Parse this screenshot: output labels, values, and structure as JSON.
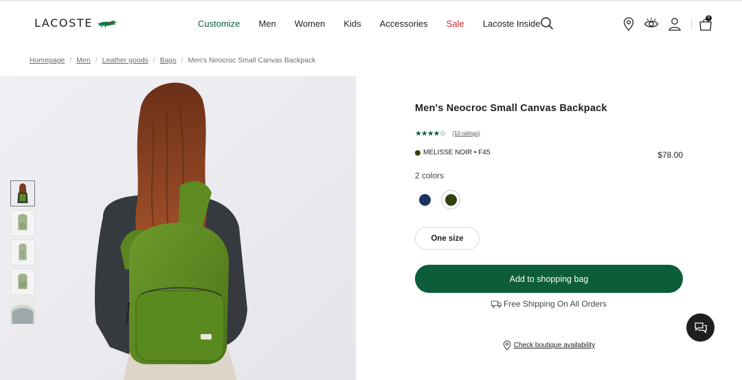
{
  "brand": {
    "name": "LACOSTE",
    "logo_icon": "crocodile-icon"
  },
  "nav": {
    "items": [
      "Customize",
      "Men",
      "Women",
      "Kids",
      "Accessories",
      "Sale",
      "Lacoste Inside"
    ],
    "search_icon": "search-icon"
  },
  "header_icons": {
    "store_locator": "location-pin-icon",
    "accessibility": "eye-icon",
    "account": "user-icon",
    "bag": "shopping-bag-icon",
    "bag_count": "0"
  },
  "breadcrumb": {
    "items": [
      "Homepage",
      "Men",
      "Leather goods",
      "Bags"
    ],
    "current": "Men's Neocroc Small Canvas Backpack"
  },
  "product": {
    "name": "Men's Neocroc Small Canvas Backpack",
    "rating_stars": 4,
    "rating_max": 5,
    "rating_text": "(10 ratings)",
    "variant_name": "MELISSE NOIR • F45",
    "price": "$78.00",
    "colors_label": "2 colors",
    "size_label": "One size",
    "add_to_bag_label": "Add to shopping bag",
    "shipping_text": "Free Shipping On All Orders",
    "boutique_text": "Check boutique availability",
    "thumbnail_count": 5,
    "selected_thumbnail": 1,
    "selected_color": 2
  },
  "colors": {
    "brand_green": "#0d5c3a",
    "sale_red": "#d6202b",
    "swatch_navy": "#1c3262",
    "swatch_green": "#33420e",
    "backpack_green": "#5c8a22"
  },
  "chat": {
    "icon": "chat-icon"
  }
}
